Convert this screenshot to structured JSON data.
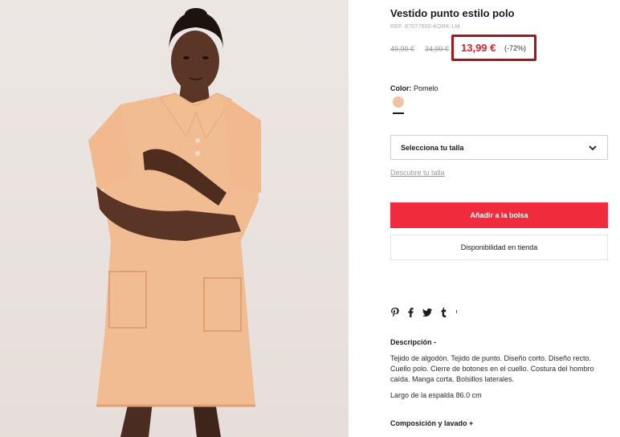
{
  "product": {
    "title": "Vestido punto estilo polo",
    "ref": "REF. 87077650-KORK-LM",
    "old_price_1": "49,99 €",
    "old_price_2": "34,99 €",
    "sale_price": "13,99 €",
    "discount": "(-72%)"
  },
  "color": {
    "label": "Color:",
    "value": "Pomelo",
    "swatch_hex": "#f2c3a3"
  },
  "size": {
    "placeholder": "Selecciona tu talla",
    "guide_link": "Descubre tu talla"
  },
  "actions": {
    "add_to_bag": "Añadir a la bolsa",
    "store_availability": "Disponibilidad en tienda"
  },
  "social": {
    "icons": [
      "pinterest-icon",
      "facebook-icon",
      "twitter-icon",
      "tumblr-icon",
      "more-icon"
    ]
  },
  "description": {
    "title": "Descripción  -",
    "text": "Tejido de algodón. Tejido de punto. Diseño corto. Diseño recto. Cuello polo. Cierre de botones en el cuello. Costura del hombro caída. Manga corta. Bolsillos laterales.",
    "back_length": "Largo de la espalda 86.0 cm"
  },
  "composition": {
    "title": "Composición y lavado  +"
  },
  "colors": {
    "accent_red": "#ef2b3d",
    "sale_red": "#e0202e",
    "highlight_box": "#a8141a"
  }
}
